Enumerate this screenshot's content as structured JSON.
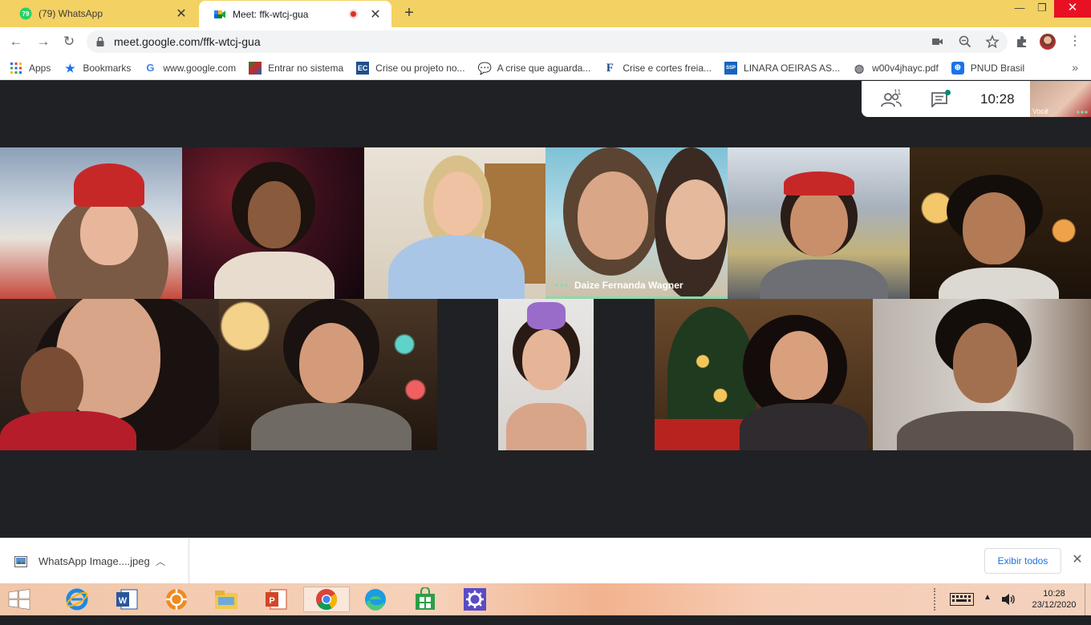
{
  "browser": {
    "tabs": [
      {
        "title": "(79) WhatsApp",
        "badge": "79",
        "active": false
      },
      {
        "title": "Meet: ffk-wtcj-gua",
        "active": true
      }
    ],
    "url": "meet.google.com/ffk-wtcj-gua",
    "bookmarks": [
      {
        "label": "Apps",
        "icon": "apps-grid-icon"
      },
      {
        "label": "Bookmarks",
        "icon": "star-icon"
      },
      {
        "label": "www.google.com",
        "icon": "google-icon"
      },
      {
        "label": "Entrar no sistema",
        "icon": "site-icon"
      },
      {
        "label": "Crise ou projeto no...",
        "icon": "ec-icon",
        "abbr": "EC"
      },
      {
        "label": "A crise que aguarda...",
        "icon": "chat-bubble-icon"
      },
      {
        "label": "Crise e cortes freia...",
        "icon": "f-icon",
        "abbr": "F"
      },
      {
        "label": "LINARA OEIRAS AS...",
        "icon": "ssp-icon",
        "abbr": "SSP"
      },
      {
        "label": "w00v4jhayc.pdf",
        "icon": "globe-icon"
      },
      {
        "label": "PNUD Brasil",
        "icon": "un-icon"
      }
    ],
    "bookmarks_more": "»"
  },
  "meet": {
    "participants_count": "11",
    "time": "10:28",
    "self_label": "Você",
    "speaker_name": "Daize Fernanda Wagner"
  },
  "downloads": {
    "file_name": "WhatsApp Image....jpeg",
    "show_all": "Exibir todos"
  },
  "taskbar": {
    "time": "10:28",
    "date": "23/12/2020"
  },
  "colors": {
    "tab_strip": "#f3d163",
    "meet_bg": "#202124",
    "speaker_bar": "#8ad9ad",
    "accent": "#1a73e8"
  }
}
